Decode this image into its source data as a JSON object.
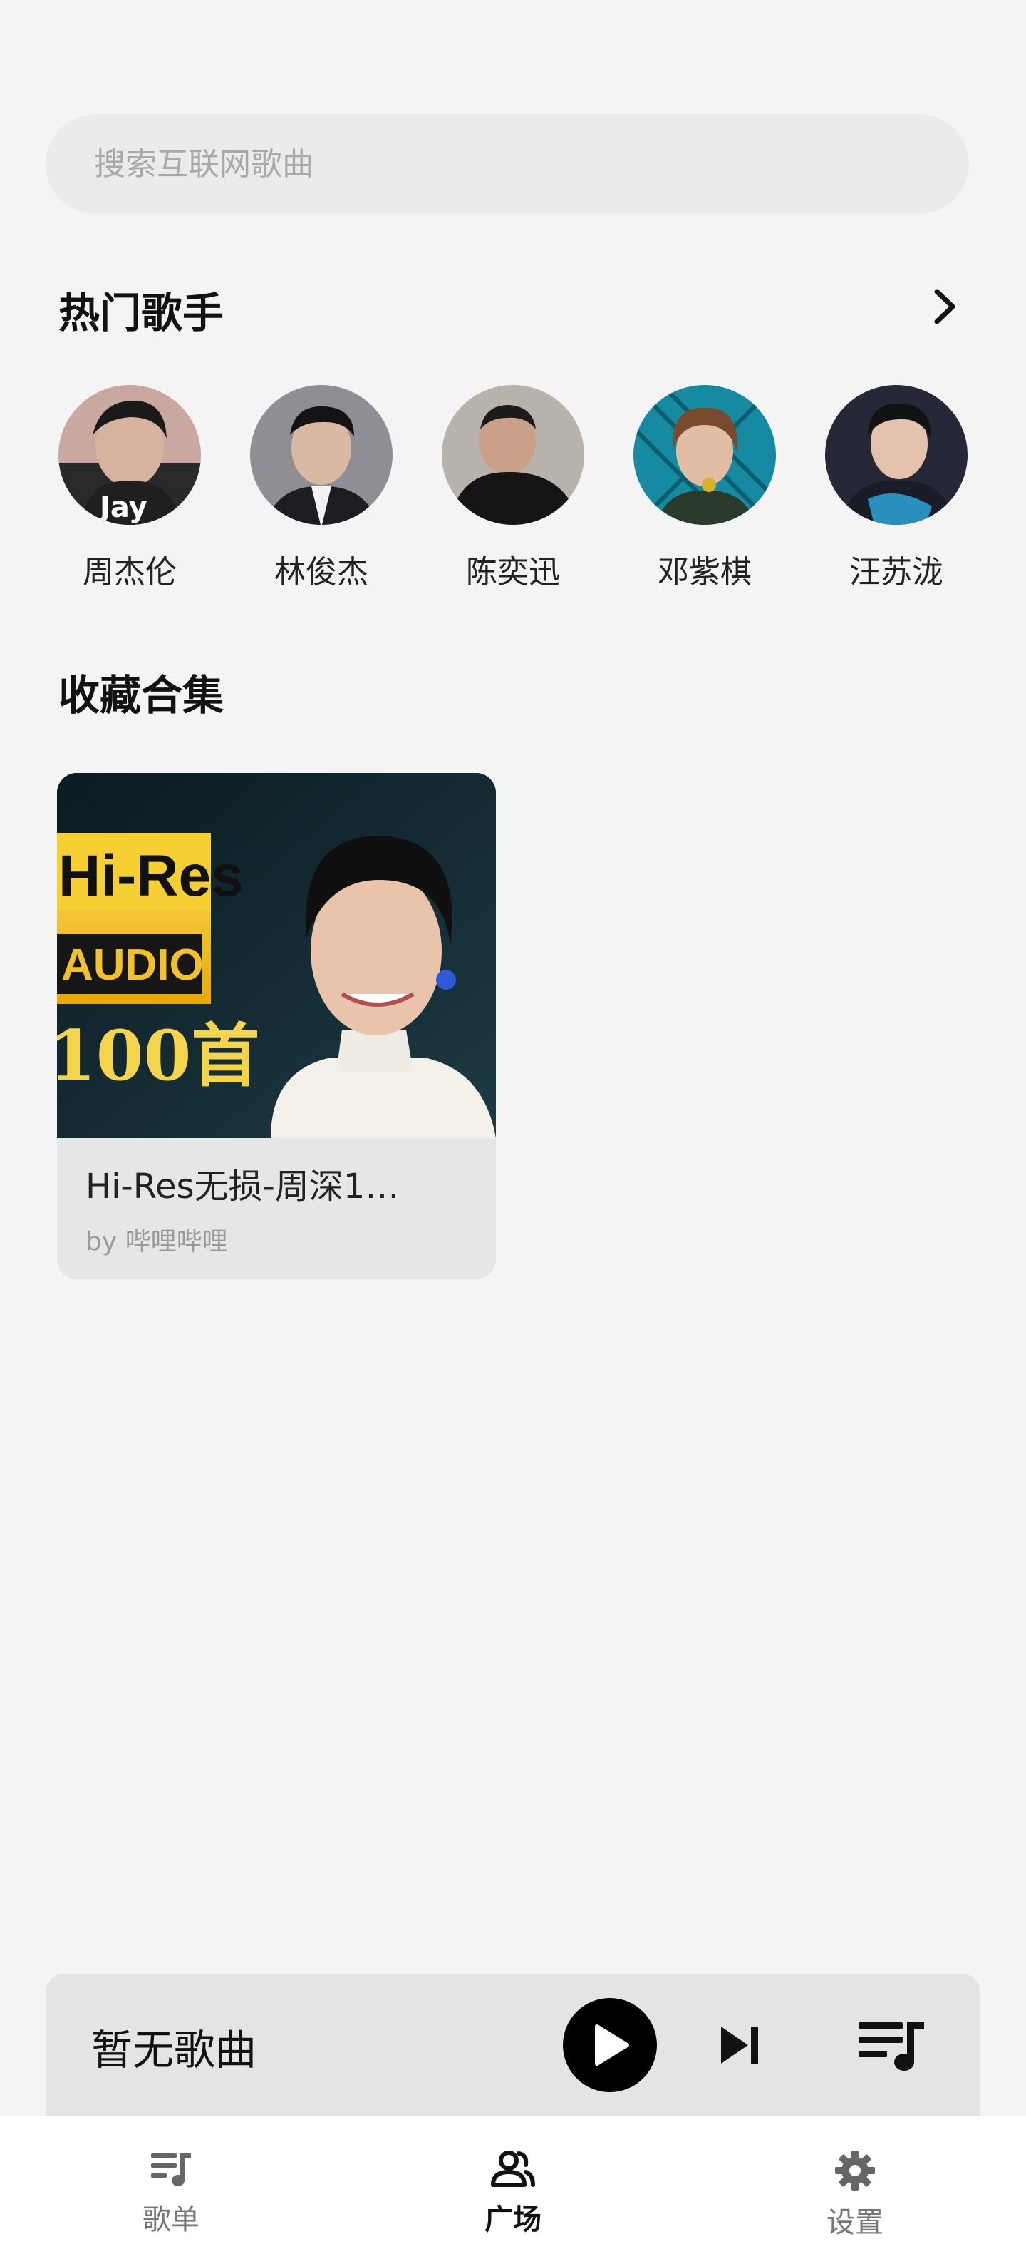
{
  "search": {
    "placeholder": "搜索互联网歌曲"
  },
  "hot_singers": {
    "title": "热门歌手",
    "items": [
      {
        "name": "周杰伦",
        "avatar_tag": "Jay"
      },
      {
        "name": "林俊杰"
      },
      {
        "name": "陈奕迅"
      },
      {
        "name": "邓紫棋"
      },
      {
        "name": "汪苏泷"
      }
    ]
  },
  "collections": {
    "title": "收藏合集",
    "items": [
      {
        "title": "Hi-Res无损-周深1…",
        "subtitle": "by 哔哩哔哩",
        "cover_badge": "Hi-Res",
        "cover_badge_sub": "AUDIO",
        "cover_text": "100首"
      }
    ]
  },
  "player": {
    "title": "暂无歌曲"
  },
  "bottom_nav": {
    "items": [
      {
        "label": "歌单",
        "icon": "playlist-icon"
      },
      {
        "label": "广场",
        "icon": "people-icon",
        "active": true
      },
      {
        "label": "设置",
        "icon": "gear-icon"
      }
    ]
  },
  "colors": {
    "background": "#f4f4f4",
    "search_bg": "#ebebeb",
    "card_bg": "#e6e6e6",
    "player_bg": "#e4e4e4",
    "accent": "#000000"
  }
}
